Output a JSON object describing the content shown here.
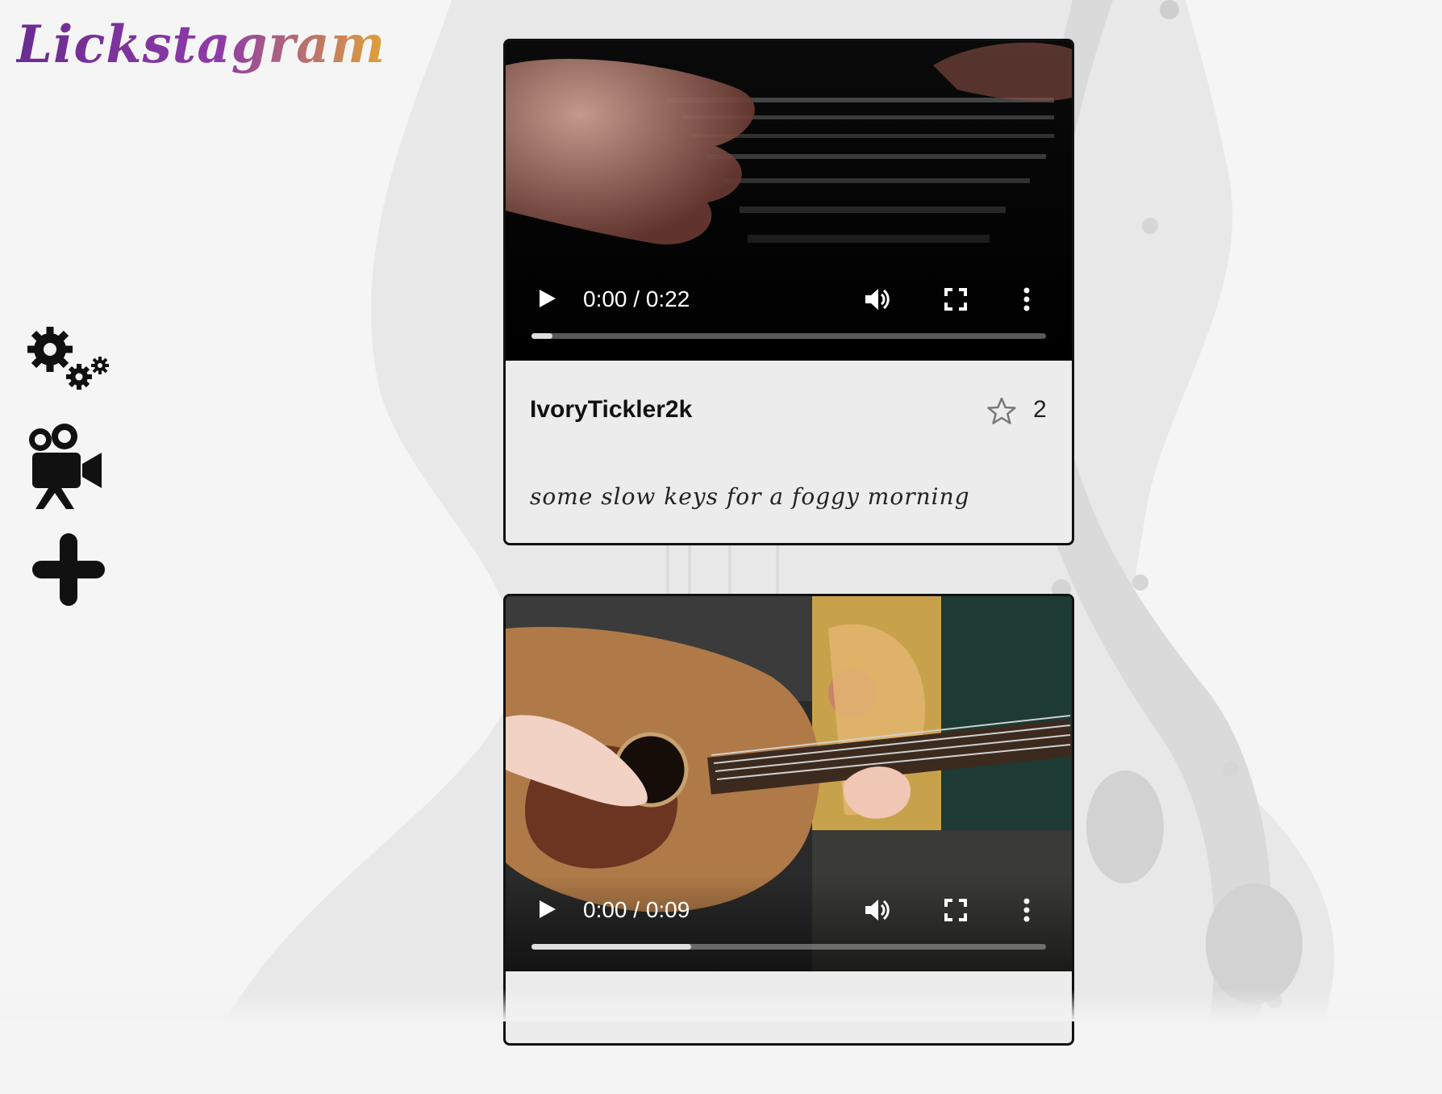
{
  "app": {
    "logo_text": "Lickstagram"
  },
  "nav": [
    {
      "name": "settings",
      "icon": "gears-icon"
    },
    {
      "name": "videos",
      "icon": "movie-camera-icon"
    },
    {
      "name": "add",
      "icon": "plus-icon"
    }
  ],
  "posts": [
    {
      "video": {
        "time": "0:00 / 0:22",
        "progress": 0.04,
        "scene": "piano-keys"
      },
      "username": "IvoryTickler2k",
      "star_count": "2",
      "caption": "some slow keys for a foggy morning"
    },
    {
      "video": {
        "time": "0:00 / 0:09",
        "progress": 0.31,
        "scene": "acoustic-guitar"
      }
    }
  ],
  "colors": {
    "logo_start": "#6a2c91",
    "logo_end": "#e0a23a",
    "card_border": "#111111",
    "card_bg": "#ececec"
  }
}
